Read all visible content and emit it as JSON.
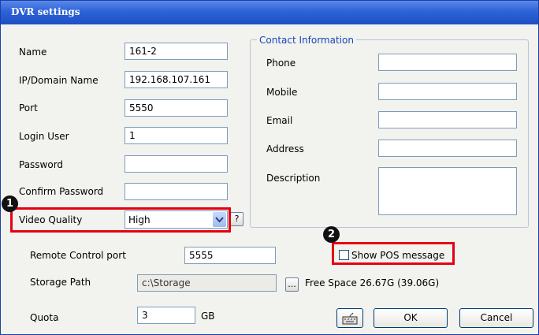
{
  "window": {
    "title": "DVR settings"
  },
  "left_fields": [
    {
      "label": "Name",
      "value": "161-2"
    },
    {
      "label": "IP/Domain Name",
      "value": "192.168.107.161"
    },
    {
      "label": "Port",
      "value": "5550"
    },
    {
      "label": "Login User",
      "value": "1"
    },
    {
      "label": "Password",
      "value": ""
    },
    {
      "label": "Confirm Password",
      "value": ""
    }
  ],
  "video_quality": {
    "label": "Video Quality",
    "value": "High",
    "help_label": "?"
  },
  "contact": {
    "title": "Contact Information",
    "fields": [
      {
        "label": "Phone",
        "value": ""
      },
      {
        "label": "Mobile",
        "value": ""
      },
      {
        "label": "Email",
        "value": ""
      },
      {
        "label": "Address",
        "value": ""
      },
      {
        "label": "Description",
        "value": ""
      }
    ]
  },
  "remote_control": {
    "label": "Remote Control port",
    "value": "5555"
  },
  "show_pos": {
    "label": "Show POS message",
    "checked": false
  },
  "storage": {
    "label": "Storage Path",
    "value": "c:\\Storage",
    "browse_label": "...",
    "free_space": "Free Space 26.67G (39.06G)"
  },
  "quota": {
    "label": "Quota",
    "value": "3",
    "unit": "GB"
  },
  "buttons": {
    "ok": "OK",
    "cancel": "Cancel"
  },
  "markers": {
    "one": "1",
    "two": "2"
  },
  "colors": {
    "highlight": "#e60012",
    "title_bar": "#2d63d8"
  }
}
